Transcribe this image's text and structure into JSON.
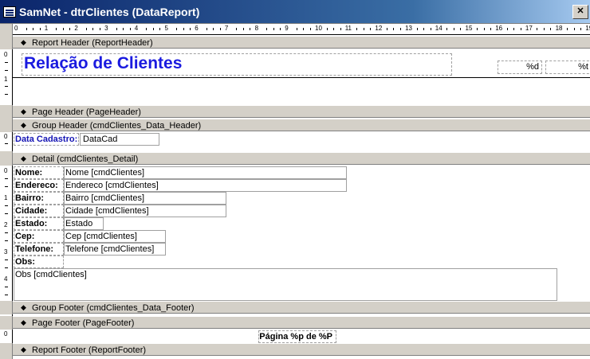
{
  "window": {
    "title": "SamNet - dtrClientes (DataReport)",
    "close_glyph": "✕"
  },
  "ruler": {
    "labels": [
      "0",
      "1",
      "2",
      "3",
      "4",
      "5",
      "6",
      "7",
      "8",
      "9",
      "10",
      "11",
      "12",
      "13",
      "14",
      "15",
      "16",
      "17",
      "18",
      "19"
    ]
  },
  "sections": {
    "report_header": "Report Header (ReportHeader)",
    "page_header": "Page Header (PageHeader)",
    "group_header": "Group Header (cmdClientes_Data_Header)",
    "detail": "Detail (cmdClientes_Detail)",
    "group_footer": "Group Footer (cmdClientes_Data_Footer)",
    "page_footer": "Page Footer (PageFooter)",
    "report_footer": "Report Footer (ReportFooter)"
  },
  "report_header": {
    "title": "Relação de Clientes",
    "date_field": "%d",
    "time_field": "%t"
  },
  "group_header": {
    "label": "Data Cadastro:",
    "field": "DataCad"
  },
  "detail": {
    "rows": [
      {
        "label": "Nome:",
        "field": "Nome [cmdClientes]"
      },
      {
        "label": "Endereco:",
        "field": "Endereco [cmdClientes]"
      },
      {
        "label": "Bairro:",
        "field": "Bairro [cmdClientes]"
      },
      {
        "label": "Cidade:",
        "field": "Cidade [cmdClientes]"
      },
      {
        "label": "Estado:",
        "field": "Estado"
      },
      {
        "label": "Cep:",
        "field": "Cep [cmdClientes]"
      },
      {
        "label": "Telefone:",
        "field": "Telefone [cmdClientes]"
      },
      {
        "label": "Obs:",
        "field": ""
      }
    ],
    "obs_field": "Obs [cmdClientes]"
  },
  "page_footer": {
    "page_text": "Página %p de %P"
  },
  "vruler": {
    "rh": [
      "0",
      "1"
    ],
    "gh": [
      "0"
    ],
    "detail": [
      "0",
      "1",
      "2",
      "3",
      "4"
    ],
    "pf": [
      "0"
    ]
  }
}
